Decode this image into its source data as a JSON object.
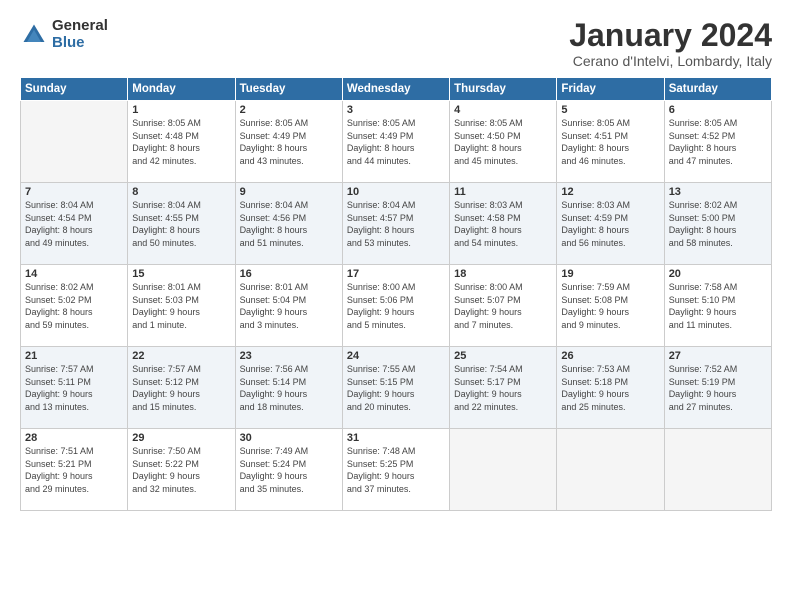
{
  "logo": {
    "general": "General",
    "blue": "Blue"
  },
  "title": "January 2024",
  "location": "Cerano d'Intelvi, Lombardy, Italy",
  "days_of_week": [
    "Sunday",
    "Monday",
    "Tuesday",
    "Wednesday",
    "Thursday",
    "Friday",
    "Saturday"
  ],
  "weeks": [
    [
      {
        "day": "",
        "info": ""
      },
      {
        "day": "1",
        "info": "Sunrise: 8:05 AM\nSunset: 4:48 PM\nDaylight: 8 hours\nand 42 minutes."
      },
      {
        "day": "2",
        "info": "Sunrise: 8:05 AM\nSunset: 4:49 PM\nDaylight: 8 hours\nand 43 minutes."
      },
      {
        "day": "3",
        "info": "Sunrise: 8:05 AM\nSunset: 4:49 PM\nDaylight: 8 hours\nand 44 minutes."
      },
      {
        "day": "4",
        "info": "Sunrise: 8:05 AM\nSunset: 4:50 PM\nDaylight: 8 hours\nand 45 minutes."
      },
      {
        "day": "5",
        "info": "Sunrise: 8:05 AM\nSunset: 4:51 PM\nDaylight: 8 hours\nand 46 minutes."
      },
      {
        "day": "6",
        "info": "Sunrise: 8:05 AM\nSunset: 4:52 PM\nDaylight: 8 hours\nand 47 minutes."
      }
    ],
    [
      {
        "day": "7",
        "info": "Sunrise: 8:04 AM\nSunset: 4:54 PM\nDaylight: 8 hours\nand 49 minutes."
      },
      {
        "day": "8",
        "info": "Sunrise: 8:04 AM\nSunset: 4:55 PM\nDaylight: 8 hours\nand 50 minutes."
      },
      {
        "day": "9",
        "info": "Sunrise: 8:04 AM\nSunset: 4:56 PM\nDaylight: 8 hours\nand 51 minutes."
      },
      {
        "day": "10",
        "info": "Sunrise: 8:04 AM\nSunset: 4:57 PM\nDaylight: 8 hours\nand 53 minutes."
      },
      {
        "day": "11",
        "info": "Sunrise: 8:03 AM\nSunset: 4:58 PM\nDaylight: 8 hours\nand 54 minutes."
      },
      {
        "day": "12",
        "info": "Sunrise: 8:03 AM\nSunset: 4:59 PM\nDaylight: 8 hours\nand 56 minutes."
      },
      {
        "day": "13",
        "info": "Sunrise: 8:02 AM\nSunset: 5:00 PM\nDaylight: 8 hours\nand 58 minutes."
      }
    ],
    [
      {
        "day": "14",
        "info": "Sunrise: 8:02 AM\nSunset: 5:02 PM\nDaylight: 8 hours\nand 59 minutes."
      },
      {
        "day": "15",
        "info": "Sunrise: 8:01 AM\nSunset: 5:03 PM\nDaylight: 9 hours\nand 1 minute."
      },
      {
        "day": "16",
        "info": "Sunrise: 8:01 AM\nSunset: 5:04 PM\nDaylight: 9 hours\nand 3 minutes."
      },
      {
        "day": "17",
        "info": "Sunrise: 8:00 AM\nSunset: 5:06 PM\nDaylight: 9 hours\nand 5 minutes."
      },
      {
        "day": "18",
        "info": "Sunrise: 8:00 AM\nSunset: 5:07 PM\nDaylight: 9 hours\nand 7 minutes."
      },
      {
        "day": "19",
        "info": "Sunrise: 7:59 AM\nSunset: 5:08 PM\nDaylight: 9 hours\nand 9 minutes."
      },
      {
        "day": "20",
        "info": "Sunrise: 7:58 AM\nSunset: 5:10 PM\nDaylight: 9 hours\nand 11 minutes."
      }
    ],
    [
      {
        "day": "21",
        "info": "Sunrise: 7:57 AM\nSunset: 5:11 PM\nDaylight: 9 hours\nand 13 minutes."
      },
      {
        "day": "22",
        "info": "Sunrise: 7:57 AM\nSunset: 5:12 PM\nDaylight: 9 hours\nand 15 minutes."
      },
      {
        "day": "23",
        "info": "Sunrise: 7:56 AM\nSunset: 5:14 PM\nDaylight: 9 hours\nand 18 minutes."
      },
      {
        "day": "24",
        "info": "Sunrise: 7:55 AM\nSunset: 5:15 PM\nDaylight: 9 hours\nand 20 minutes."
      },
      {
        "day": "25",
        "info": "Sunrise: 7:54 AM\nSunset: 5:17 PM\nDaylight: 9 hours\nand 22 minutes."
      },
      {
        "day": "26",
        "info": "Sunrise: 7:53 AM\nSunset: 5:18 PM\nDaylight: 9 hours\nand 25 minutes."
      },
      {
        "day": "27",
        "info": "Sunrise: 7:52 AM\nSunset: 5:19 PM\nDaylight: 9 hours\nand 27 minutes."
      }
    ],
    [
      {
        "day": "28",
        "info": "Sunrise: 7:51 AM\nSunset: 5:21 PM\nDaylight: 9 hours\nand 29 minutes."
      },
      {
        "day": "29",
        "info": "Sunrise: 7:50 AM\nSunset: 5:22 PM\nDaylight: 9 hours\nand 32 minutes."
      },
      {
        "day": "30",
        "info": "Sunrise: 7:49 AM\nSunset: 5:24 PM\nDaylight: 9 hours\nand 35 minutes."
      },
      {
        "day": "31",
        "info": "Sunrise: 7:48 AM\nSunset: 5:25 PM\nDaylight: 9 hours\nand 37 minutes."
      },
      {
        "day": "",
        "info": ""
      },
      {
        "day": "",
        "info": ""
      },
      {
        "day": "",
        "info": ""
      }
    ]
  ]
}
